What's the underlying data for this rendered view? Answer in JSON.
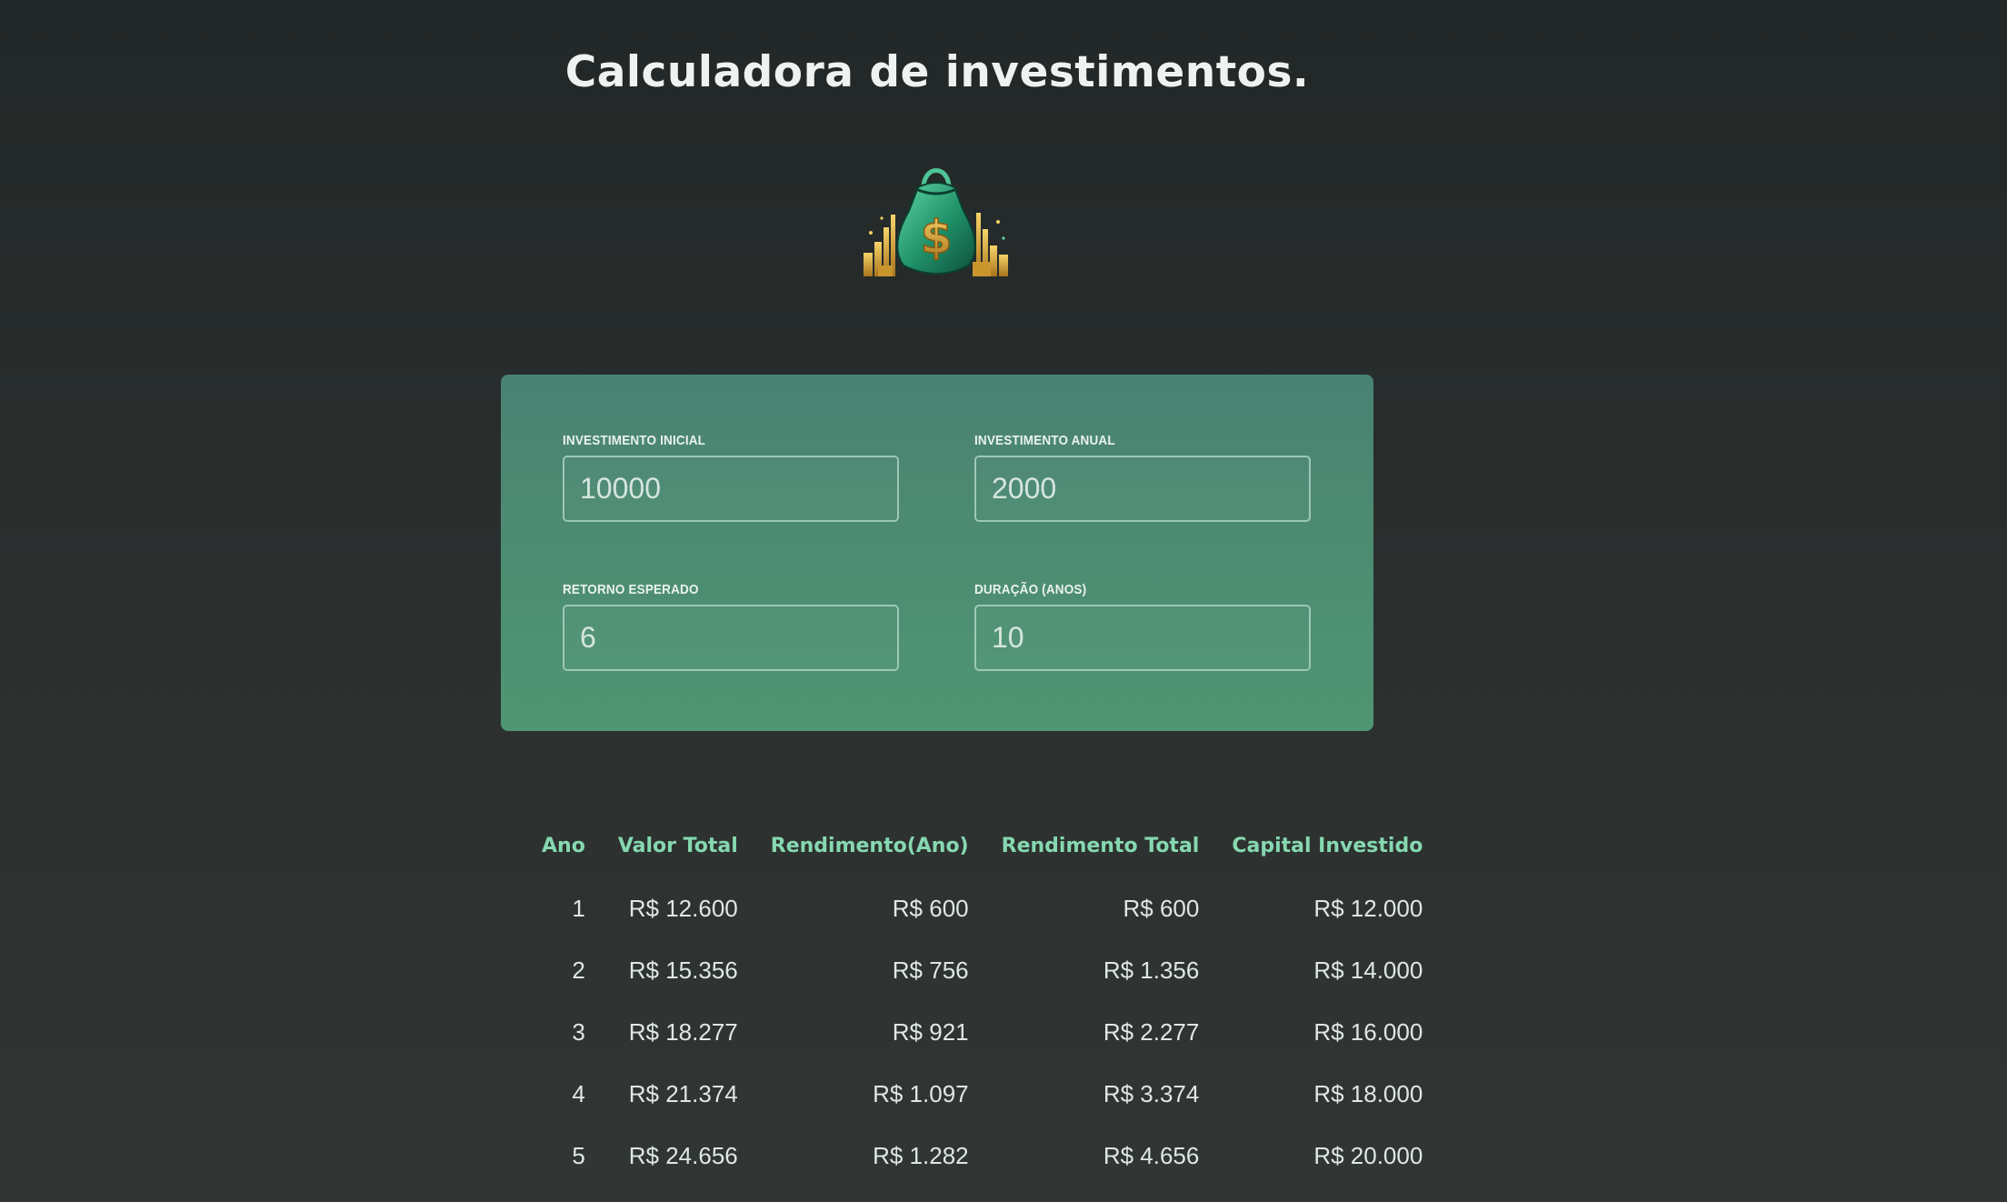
{
  "page": {
    "title": "Calculadora de investimentos."
  },
  "logo": {
    "icon": "money-bag-icon",
    "symbol": "$"
  },
  "form": {
    "initial": {
      "label": "INVESTIMENTO INICIAL",
      "value": "10000"
    },
    "annual": {
      "label": "INVESTIMENTO ANUAL",
      "value": "2000"
    },
    "expected_return": {
      "label": "RETORNO ESPERADO",
      "value": "6"
    },
    "duration": {
      "label": "DURAÇÃO (ANOS)",
      "value": "10"
    }
  },
  "table": {
    "headers": [
      "Ano",
      "Valor Total",
      "Rendimento(Ano)",
      "Rendimento Total",
      "Capital Investido"
    ],
    "rows": [
      [
        "1",
        "R$ 12.600",
        "R$ 600",
        "R$ 600",
        "R$ 12.000"
      ],
      [
        "2",
        "R$ 15.356",
        "R$ 756",
        "R$ 1.356",
        "R$ 14.000"
      ],
      [
        "3",
        "R$ 18.277",
        "R$ 921",
        "R$ 2.277",
        "R$ 16.000"
      ],
      [
        "4",
        "R$ 21.374",
        "R$ 1.097",
        "R$ 3.374",
        "R$ 18.000"
      ],
      [
        "5",
        "R$ 24.656",
        "R$ 1.282",
        "R$ 4.656",
        "R$ 20.000"
      ]
    ]
  },
  "colors": {
    "background": "#262b2a",
    "card": "#4a8c73",
    "header_text": "#86d8b0",
    "input_border": "#9cc8b6"
  }
}
